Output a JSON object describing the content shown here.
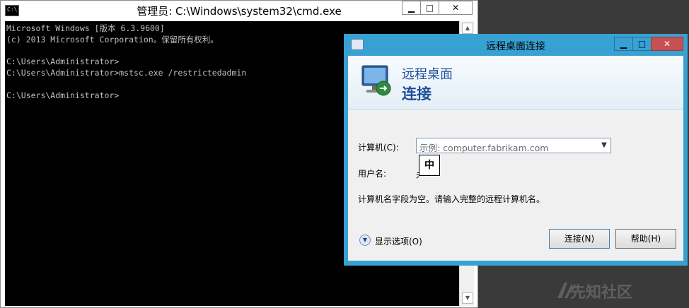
{
  "cmd": {
    "title": "管理员: C:\\Windows\\system32\\cmd.exe",
    "icon_text": "C:\\",
    "buttons": {
      "min": "▁",
      "max": "□",
      "close": "✕"
    },
    "lines": [
      "Microsoft Windows [版本 6.3.9600]",
      "(c) 2013 Microsoft Corporation。保留所有权利。",
      "",
      "C:\\Users\\Administrator>",
      "C:\\Users\\Administrator>mstsc.exe /restrictedadmin",
      "",
      "C:\\Users\\Administrator>"
    ]
  },
  "rdp": {
    "title": "远程桌面连接",
    "buttons": {
      "min": "▁",
      "max": "□",
      "close": "✕"
    },
    "banner": {
      "line1": "远程桌面",
      "line2": "连接"
    },
    "computer_label": "计算机(C):",
    "computer_placeholder": "示例: computer.fabrikam.com",
    "ime_indicator": "中",
    "user_label": "用户名:",
    "user_value_partial": "未",
    "message": "计算机名字段为空。请输入完整的远程计算机名。",
    "options_label": "显示选项(O)",
    "connect_button": "连接(N)",
    "help_button": "帮助(H)"
  },
  "watermark": "先知社区",
  "colors": {
    "rdp_frame": "#38a1d3",
    "banner_text": "#1f4e9a",
    "close_red": "#c75050"
  }
}
